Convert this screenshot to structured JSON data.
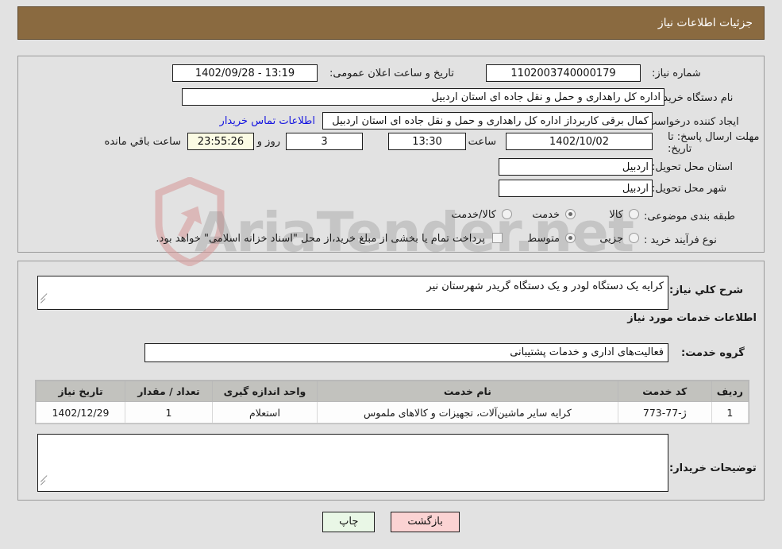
{
  "header": {
    "title": "جزئیات اطلاعات نیاز"
  },
  "form": {
    "need_number_label": "شماره نیاز:",
    "need_number_value": "1102003740000179",
    "announce_label": "تاریخ و ساعت اعلان عمومی:",
    "announce_value": "13:19 - 1402/09/28",
    "buyer_org_label": "نام دستگاه خریدار:",
    "buyer_org_value": "اداره کل راهداری و حمل و نقل جاده ای استان اردبیل",
    "requester_label": "ایجاد کننده درخواست:",
    "requester_value": "کمال برقی کاربرداز اداره کل راهداری و حمل و نقل جاده ای استان اردبیل",
    "contact_link": "اطلاعات تماس خریدار",
    "deadline_label": "مهلت ارسال پاسخ: تا تاریخ:",
    "deadline_date": "1402/10/02",
    "hour_label": "ساعت",
    "hour_value": "13:30",
    "days_value": "3",
    "days_label": "روز و",
    "countdown_value": "23:55:26",
    "countdown_label": "ساعت باقي مانده",
    "province_label": "استان محل تحویل:",
    "province_value": "اردبیل",
    "city_label": "شهر محل تحویل:",
    "city_value": "اردبیل",
    "category_label": "طبقه بندی موضوعی:",
    "category_options": [
      "کالا",
      "خدمت",
      "کالا/خدمت"
    ],
    "category_selected": "خدمت",
    "process_label": "نوع فرآیند خرید :",
    "process_options": [
      "جزیی",
      "متوسط"
    ],
    "process_selected": "متوسط",
    "treasury_note": "پرداخت تمام یا بخشی از مبلغ خرید،از محل \"اسناد خزانه اسلامی\" خواهد بود."
  },
  "description": {
    "label": "شرح کلي نیاز:",
    "value": "کرایه یک دستگاه لودر و یک دستگاه گریدر شهرستان نیر"
  },
  "services_section": {
    "heading": "اطلاعات خدمات مورد نیاز",
    "group_label": "گروه خدمت:",
    "group_value": "فعالیت‌های اداری و خدمات پشتیبانی"
  },
  "table": {
    "headers": [
      "ردیف",
      "کد خدمت",
      "نام خدمت",
      "واحد اندازه گیری",
      "تعداد / مقدار",
      "تاریخ نیاز"
    ],
    "rows": [
      {
        "row": "1",
        "code": "ژ-77-773",
        "name": "کرایه سایر ماشین‌آلات، تجهیزات و کالاهای ملموس",
        "unit": "استعلام",
        "qty": "1",
        "date": "1402/12/29"
      }
    ]
  },
  "notes": {
    "label": "توضیحات خریدار:",
    "value": ""
  },
  "buttons": {
    "print": "چاپ",
    "back": "بازگشت"
  },
  "watermark": {
    "text": "AriaTender.net"
  },
  "colors": {
    "header_bg": "#8a6a40",
    "link": "#1414e0",
    "print_btn": "#e9f7e6",
    "back_btn": "#fbd3d3",
    "countdown_bg": "#fbfbe4",
    "table_header_bg": "#c2c2be"
  }
}
